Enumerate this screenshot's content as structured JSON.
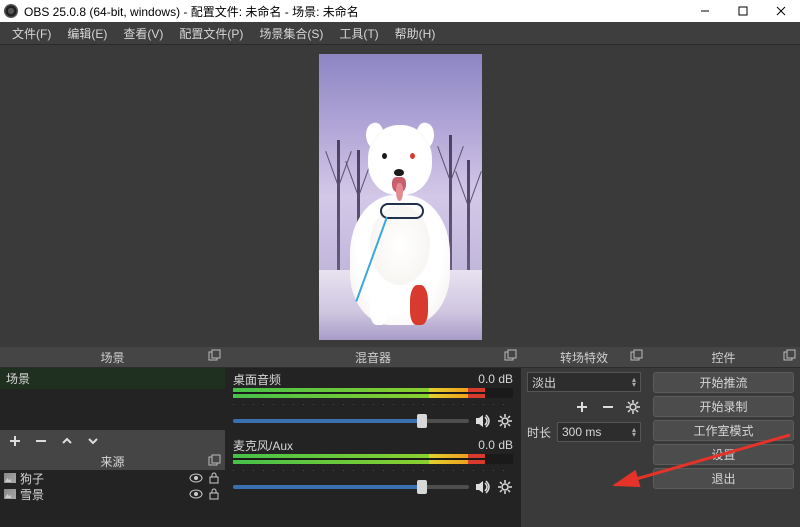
{
  "titlebar": {
    "title": "OBS 25.0.8 (64-bit, windows) - 配置文件: 未命名 - 场景: 未命名"
  },
  "menu": {
    "file": "文件(F)",
    "edit": "编辑(E)",
    "view": "查看(V)",
    "profile": "配置文件(P)",
    "scene_collection": "场景集合(S)",
    "tools": "工具(T)",
    "help": "帮助(H)"
  },
  "panels": {
    "scenes_title": "场景",
    "sources_title": "来源",
    "mixer_title": "混音器",
    "transitions_title": "转场特效",
    "controls_title": "控件"
  },
  "scenes": {
    "items": [
      {
        "name": "场景"
      }
    ]
  },
  "sources": {
    "items": [
      {
        "name": "狗子"
      },
      {
        "name": "雪景"
      }
    ]
  },
  "mixer": {
    "channels": [
      {
        "name": "桌面音频",
        "db": "0.0 dB",
        "level_pct": 78,
        "mid_pct": 10,
        "slider_pct": 80
      },
      {
        "name": "麦克风/Aux",
        "db": "0.0 dB",
        "level_pct": 78,
        "mid_pct": 10,
        "slider_pct": 80
      }
    ]
  },
  "transitions": {
    "selected": "淡出",
    "duration_label": "时长",
    "duration_value": "300 ms"
  },
  "controls": {
    "start_streaming": "开始推流",
    "start_recording": "开始录制",
    "studio_mode": "工作室模式",
    "settings": "设置",
    "exit": "退出"
  }
}
